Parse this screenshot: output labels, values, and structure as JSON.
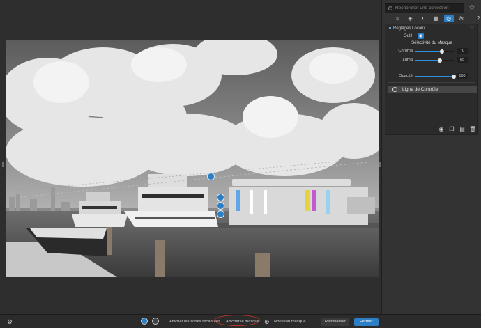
{
  "search": {
    "placeholder": "Rechercher une correction"
  },
  "panel": {
    "section_title": "Réglages Locaux",
    "tool_label": "Outil",
    "selectivity_title": "Sélectivité du Masque",
    "sliders": [
      {
        "label": "Chroma",
        "value": "70",
        "fraction": 0.7
      },
      {
        "label": "Luma",
        "value": "65",
        "fraction": 0.65
      },
      {
        "label": "Opacité",
        "value": "100",
        "fraction": 1.0
      }
    ],
    "control_line_label": "Ligne de Contrôle"
  },
  "bottom_bar": {
    "show_crop_label": "Afficher les zones recadrées",
    "show_mask_label": "Afficher le masque",
    "new_mask_label": "Nouveau masque",
    "reset_label": "Réinitialiser",
    "close_label": "Fermer"
  },
  "colors": {
    "accent": "#2c7fc4",
    "highlight_oval": "#c0392b"
  },
  "icons": [
    "search-icon",
    "star-icon",
    "help-icon",
    "sun-icon",
    "color-icon",
    "detail-icon",
    "geometry-icon",
    "local-adjust-icon",
    "fx-icon",
    "brush-icon",
    "eye-icon",
    "copy-icon",
    "trash-icon",
    "settings-icon",
    "plus-icon"
  ]
}
